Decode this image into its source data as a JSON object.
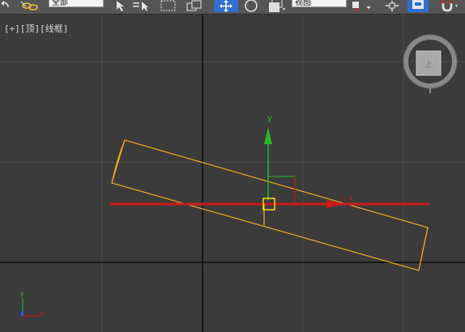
{
  "toolbar": {
    "selection_filter_value": "全部",
    "reference_coord_value": "视图",
    "accent_color": "#2e6fd1"
  },
  "viewport": {
    "label_parts": [
      "[+]",
      "[顶]",
      "[线框]"
    ],
    "view_cube_face": "上",
    "gizmo_x_label": "x",
    "gizmo_y_label": "y",
    "axis_tripod_x_label": "x",
    "axis_tripod_y_label": "y",
    "colors": {
      "background": "#3b3b3b",
      "grid": "#4b4b4b",
      "world_axis": "#0c0c0c",
      "selected_object": "#f5a623",
      "gizmo_x": "#cc1a1a",
      "gizmo_y": "#2bb52b",
      "gizmo_center": "#f5e11a"
    }
  }
}
